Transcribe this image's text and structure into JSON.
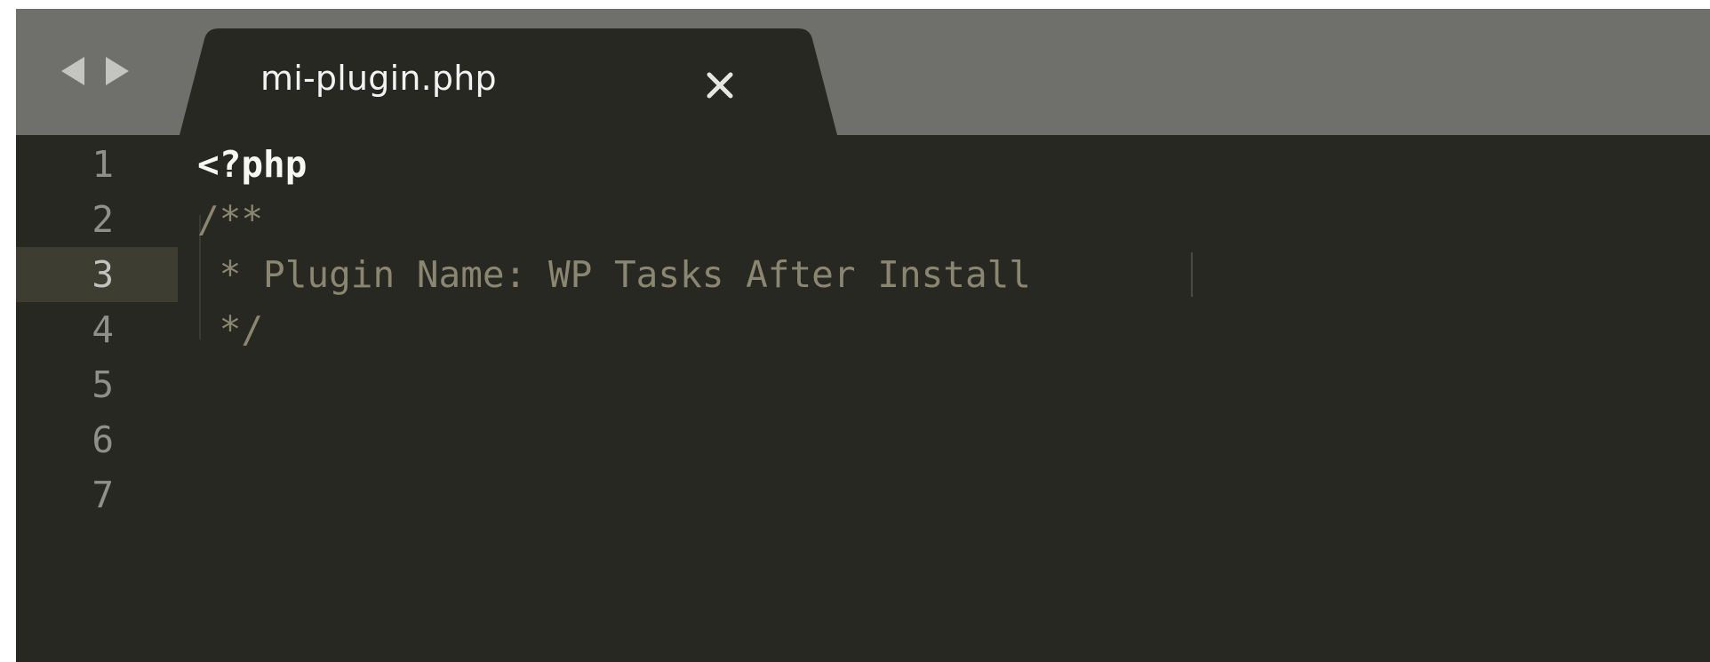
{
  "navigation": {
    "back_icon": "triangle-left-icon",
    "forward_icon": "triangle-right-icon"
  },
  "tab": {
    "title": "mi-plugin.php",
    "close_icon": "close-icon"
  },
  "editor": {
    "active_line": 3,
    "lines": [
      {
        "number": "1",
        "text": "<?php"
      },
      {
        "number": "2",
        "text": "/**"
      },
      {
        "number": "3",
        "text": " * Plugin Name: WP Tasks After Install"
      },
      {
        "number": "4",
        "text": " */"
      },
      {
        "number": "5",
        "text": ""
      },
      {
        "number": "6",
        "text": ""
      },
      {
        "number": "7",
        "text": ""
      }
    ]
  },
  "colors": {
    "tabbar_background": "#6f706b",
    "editor_background": "#272822",
    "active_line_highlight": "#3e3d32",
    "comment": "#8a8670",
    "php_tag": "#f8f8f2",
    "line_number": "#8f908a"
  }
}
